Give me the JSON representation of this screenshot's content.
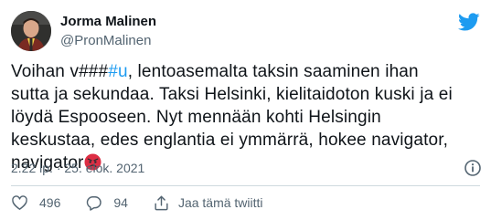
{
  "author": {
    "display_name": "Jorma Malinen",
    "handle": "@PronMalinen"
  },
  "tweet": {
    "text_lead": "Voihan v###",
    "hashtag": "#u",
    "text_rest": ", lentoasemalta taksin saaminen ihan sutta ja sekundaa. Taksi Helsinki, kielitaidoton kuski ja ei löydä Espooseen. Nyt mennään kohti Helsingin keskustaa, edes englantia ei ymmärrä, hokee navigator, navigator",
    "emoji": "angry-face-emoji"
  },
  "meta": {
    "timestamp": "2.22 ip. · 25. elok. 2021"
  },
  "actions": {
    "likes": "496",
    "replies": "94",
    "share_label": "Jaa tämä twiitti"
  },
  "colors": {
    "brand": "#1d9bf0",
    "like_red": "#f91880",
    "muted": "#536471",
    "text": "#0f1419"
  }
}
